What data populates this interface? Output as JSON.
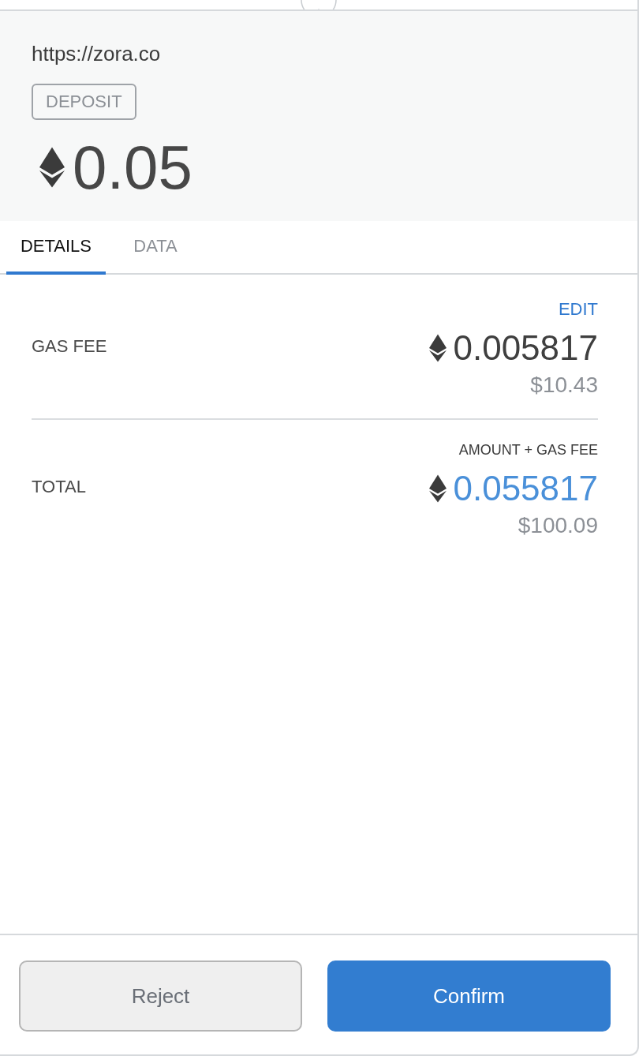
{
  "origin": "https://zora.co",
  "method": "DEPOSIT",
  "amount": "0.05",
  "tabs": [
    {
      "label": "DETAILS",
      "selected": true
    },
    {
      "label": "DATA",
      "selected": false
    }
  ],
  "rows": [
    {
      "label": "GAS FEE",
      "action": "EDIT",
      "value": "0.005817",
      "fiat": "$10.43",
      "emphasized": false
    },
    {
      "label": "TOTAL",
      "note": "AMOUNT + GAS FEE",
      "value": "0.055817",
      "fiat": "$100.09",
      "emphasized": true
    }
  ],
  "buttons": [
    {
      "label": "Reject",
      "kind": "secondary"
    },
    {
      "label": "Confirm",
      "kind": "primary"
    }
  ]
}
